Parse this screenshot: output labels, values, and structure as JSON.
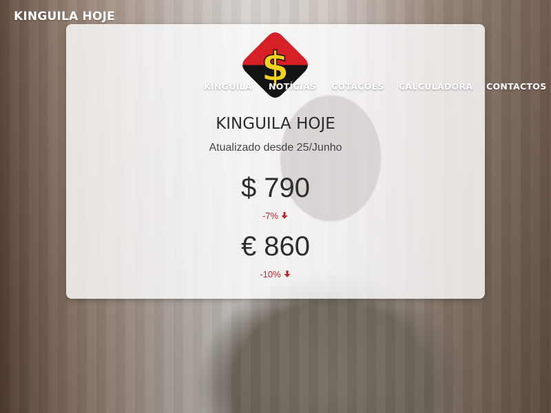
{
  "app": {
    "brand": "KINGUILA HOJE"
  },
  "nav": {
    "items": [
      {
        "label": "KINGUILA"
      },
      {
        "label": "NOTÍCIAS"
      },
      {
        "label": "COTAÇÕES"
      },
      {
        "label": "CALCULADORA"
      },
      {
        "label": "CONTACTOS"
      }
    ]
  },
  "logo": {
    "icon": "dollar-sign-logo",
    "colors": {
      "top": "#d71f26",
      "bottom": "#141414",
      "symbol": "#f2d21c"
    }
  },
  "card": {
    "title": "KINGUILA HOJE",
    "subtitle": "Atualizado desde 25/Junho",
    "rates": [
      {
        "currency": "USD",
        "display": "$ 790",
        "change": "-7%",
        "trend": "down"
      },
      {
        "currency": "EUR",
        "display": "€ 860",
        "change": "-10%",
        "trend": "down"
      }
    ]
  },
  "colors": {
    "change_negative": "#c0232a"
  }
}
